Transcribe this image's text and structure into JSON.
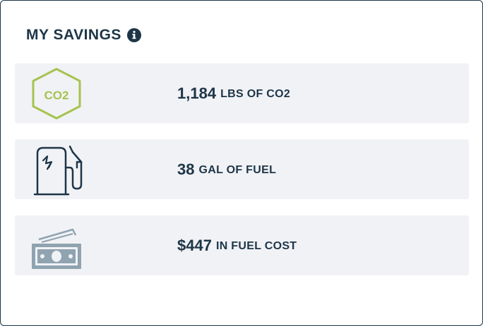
{
  "header": {
    "title": "MY SAVINGS",
    "info_icon": "info-circle-icon"
  },
  "savings": [
    {
      "icon": "co2-hexagon-icon",
      "value": "1,184",
      "unit": "LBS OF CO2",
      "icon_text": "CO2",
      "icon_color": "#a6c34f"
    },
    {
      "icon": "fuel-pump-icon",
      "value": "38",
      "unit": "GAL OF FUEL",
      "icon_color": "#1d3547"
    },
    {
      "icon": "cash-icon",
      "value": "$447",
      "unit": "IN FUEL COST",
      "icon_color": "#8fa3b0"
    }
  ],
  "colors": {
    "text": "#1d3547",
    "row_bg": "#f1f2f6",
    "co2_green": "#a6c34f",
    "cash_gray": "#8fa3b0"
  }
}
